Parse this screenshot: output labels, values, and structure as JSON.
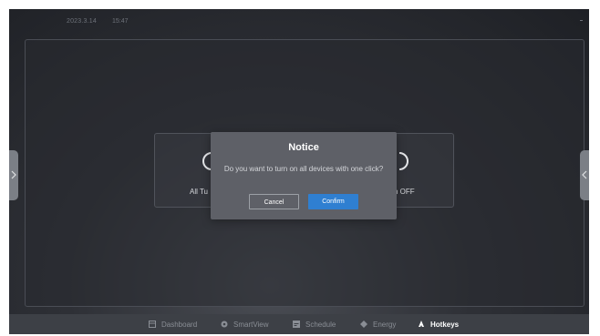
{
  "status_bar": {
    "date": "2023.3.14",
    "time": "15:47"
  },
  "cards": {
    "left_label": "All Tu",
    "right_label": "n OFF"
  },
  "modal": {
    "title": "Notice",
    "message": "Do you want to turn on all devices with one click?",
    "cancel_label": "Cancel",
    "confirm_label": "Confirm"
  },
  "nav": {
    "items": [
      {
        "label": "Dashboard",
        "icon": "dashboard-icon"
      },
      {
        "label": "SmartView",
        "icon": "smartview-icon"
      },
      {
        "label": "Schedule",
        "icon": "schedule-icon"
      },
      {
        "label": "Energy",
        "icon": "energy-icon"
      },
      {
        "label": "Hotkeys",
        "icon": "hotkeys-icon",
        "active": true
      }
    ]
  },
  "colors": {
    "accent": "#2f7fd1",
    "modal_bg": "#5e6067",
    "screen_bg": "#2e3036"
  }
}
